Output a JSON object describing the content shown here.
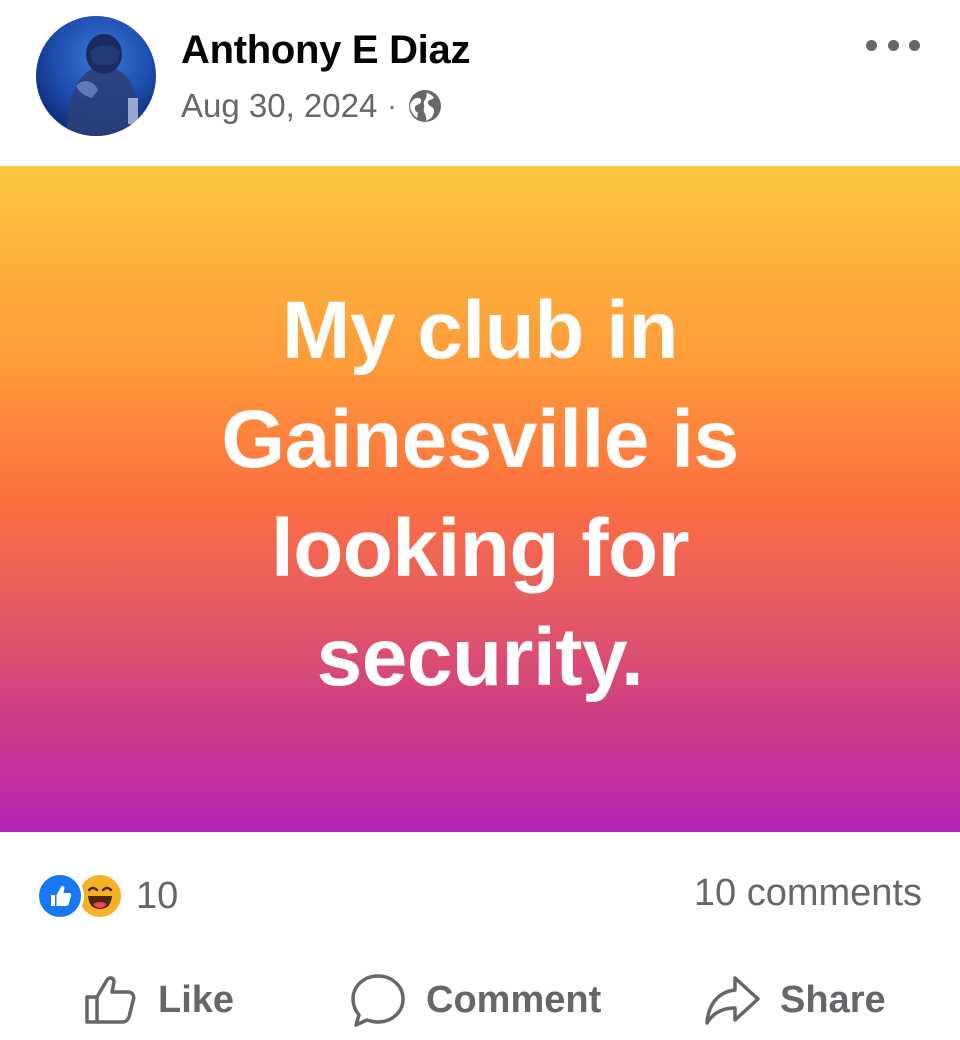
{
  "post": {
    "author": "Anthony E Diaz",
    "date": "Aug 30, 2024",
    "separator": "·",
    "privacy_icon": "globe-icon",
    "text": "My club in Gainesville is looking for security.",
    "background_gradient": [
      "#fcc93f",
      "#fd7040",
      "#b025b5"
    ]
  },
  "stats": {
    "reaction_icons": [
      "like-reaction-icon",
      "haha-reaction-icon"
    ],
    "reaction_count": "10",
    "comments_label": "10 comments"
  },
  "actions": {
    "like_label": "Like",
    "comment_label": "Comment",
    "share_label": "Share"
  },
  "colors": {
    "secondary_text": "#65676b",
    "like_blue": "#1877f2",
    "haha_yellow": "#f7b125"
  }
}
